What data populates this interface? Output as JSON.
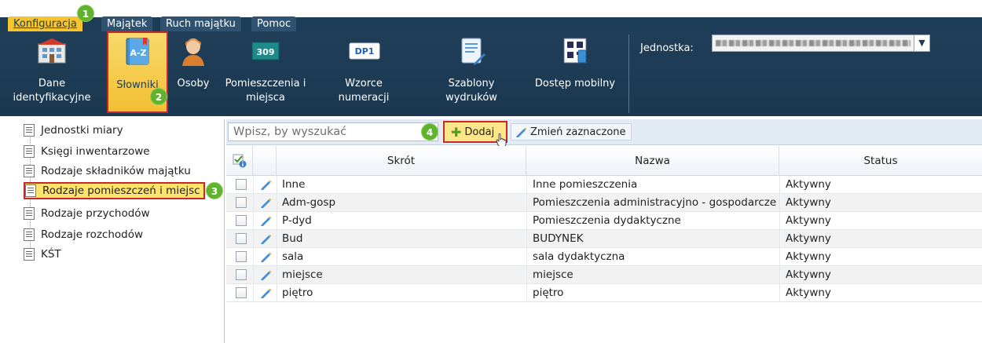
{
  "menu": {
    "tabs": [
      {
        "label": "Konfiguracja",
        "active": true
      },
      {
        "label": "Majątek",
        "active": false
      },
      {
        "label": "Ruch majątku",
        "active": false
      },
      {
        "label": "Pomoc",
        "active": false
      }
    ]
  },
  "ribbon": {
    "items": [
      {
        "label": "Dane identyfikacyjne",
        "icon": "building-icon"
      },
      {
        "label": "Słowniki",
        "icon": "dictionary-icon",
        "selected": true
      },
      {
        "label": "Osoby",
        "icon": "person-icon"
      },
      {
        "label": "Pomieszczenia i miejsca",
        "icon": "room-number-icon",
        "icon_text": "309"
      },
      {
        "label": "Wzorce numeracji",
        "icon": "numbering-icon",
        "icon_text": "DP1"
      },
      {
        "label": "Szablony wydruków",
        "icon": "print-template-icon"
      },
      {
        "label": "Dostęp mobilny",
        "icon": "qr-mobile-icon"
      }
    ],
    "jednostka_label": "Jednostka:"
  },
  "badges": {
    "b1": "1",
    "b2": "2",
    "b3": "3",
    "b4": "4"
  },
  "tree": {
    "items": [
      {
        "label": "Jednostki miary"
      },
      {
        "label": "Księgi inwentarzowe"
      },
      {
        "label": "Rodzaje składników majątku"
      },
      {
        "label": "Rodzaje pomieszczeń i miejsc",
        "selected": true
      },
      {
        "label": "Rodzaje przychodów"
      },
      {
        "label": "Rodzaje rozchodów"
      },
      {
        "label": "KŚT"
      }
    ]
  },
  "toolbar": {
    "search_placeholder": "Wpisz, by wyszukać",
    "add_label": "Dodaj",
    "edit_label": "Zmień zaznaczone"
  },
  "table": {
    "headers": {
      "skrot": "Skrót",
      "nazwa": "Nazwa",
      "status": "Status"
    },
    "rows": [
      {
        "skrot": "Inne",
        "nazwa": "Inne pomieszczenia",
        "status": "Aktywny"
      },
      {
        "skrot": "Adm-gosp",
        "nazwa": "Pomieszczenia administracyjno - gospodarcze",
        "status": "Aktywny"
      },
      {
        "skrot": "P-dyd",
        "nazwa": "Pomieszczenia dydaktyczne",
        "status": "Aktywny"
      },
      {
        "skrot": "Bud",
        "nazwa": "BUDYNEK",
        "status": "Aktywny"
      },
      {
        "skrot": "sala",
        "nazwa": "sala dydaktyczna",
        "status": "Aktywny"
      },
      {
        "skrot": "miejsce",
        "nazwa": "miejsce",
        "status": "Aktywny"
      },
      {
        "skrot": "piętro",
        "nazwa": "piętro",
        "status": "Aktywny"
      }
    ]
  },
  "colors": {
    "accent": "#f6c42c",
    "ribbon": "#1d3c55",
    "badge": "#61b22e",
    "highlight": "#c8282a"
  }
}
